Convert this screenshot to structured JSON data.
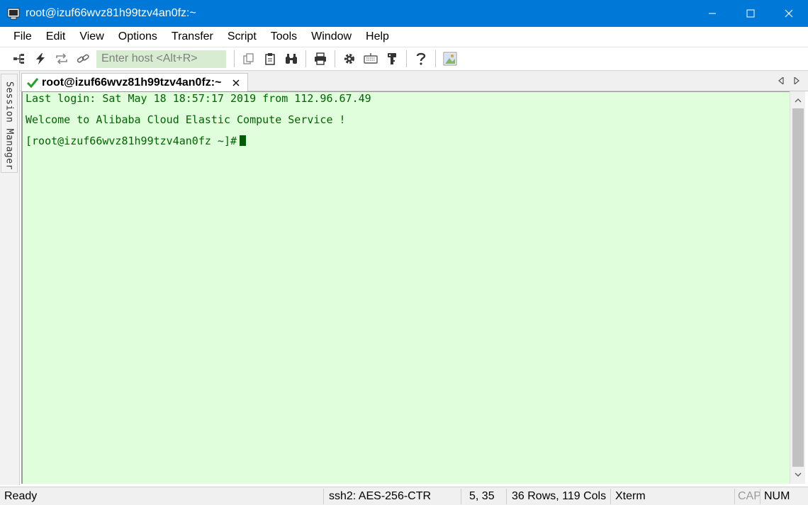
{
  "window": {
    "title": "root@izuf66wvz81h99tzv4an0fz:~",
    "minimize_icon": "minimize-icon",
    "maximize_icon": "maximize-icon",
    "close_icon": "close-icon"
  },
  "menu": [
    "File",
    "Edit",
    "View",
    "Options",
    "Transfer",
    "Script",
    "Tools",
    "Window",
    "Help"
  ],
  "toolbar": {
    "host_placeholder": "Enter host <Alt+R>"
  },
  "session_manager": {
    "label": "Session Manager"
  },
  "tab": {
    "label": "root@izuf66wvz81h99tzv4an0fz:~",
    "close": "×"
  },
  "terminal": {
    "lines": [
      "Last login: Sat May 18 18:57:17 2019 from 112.96.67.49",
      "Welcome to Alibaba Cloud Elastic Compute Service !",
      "[root@izuf66wvz81h99tzv4an0fz ~]#"
    ],
    "colors": {
      "background": "#e0fddc",
      "text": "#006400"
    }
  },
  "statusbar": {
    "status": "Ready",
    "protocol": "ssh2: AES-256-CTR",
    "cursor_pos": "5,  35",
    "dimensions": "36 Rows, 119 Cols",
    "emulation": "Xterm",
    "cap": "CAP",
    "num": "NUM"
  },
  "colors": {
    "titlebar": "#0078d7",
    "host_input_bg": "#d7ecd1"
  }
}
